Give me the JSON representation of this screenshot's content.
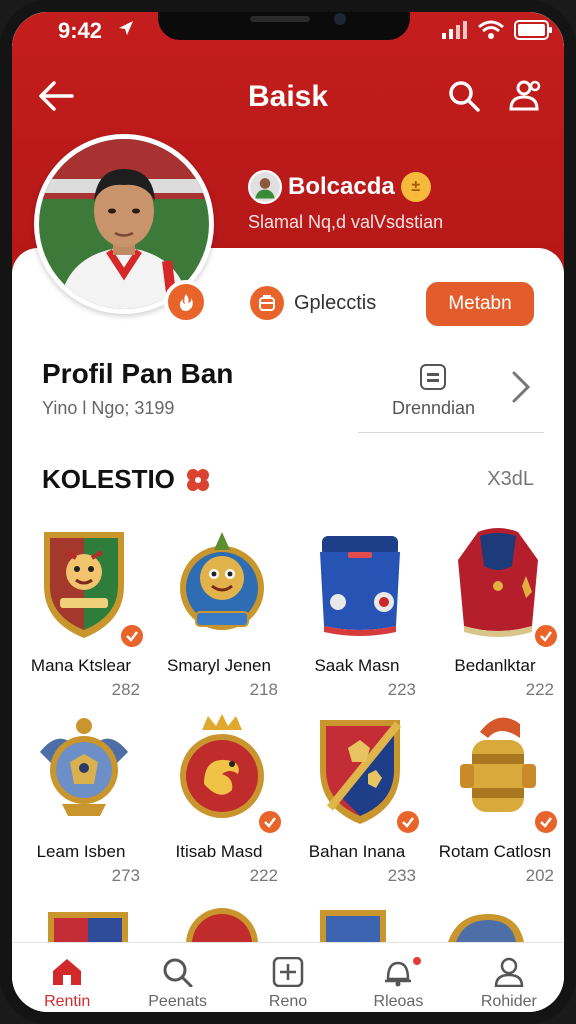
{
  "status": {
    "time": "9:42"
  },
  "app_bar": {
    "title": "Baisk"
  },
  "profile": {
    "club_name": "Bolcacda",
    "subtitle": "Slamal Nq,d valVsdstian",
    "stat_label": "Gplecctis",
    "follow_label": "Metabn",
    "title": "Profil Pan Ban",
    "meta": "Yino l Ngo; 3199",
    "detail_label": "Drenndian"
  },
  "collection": {
    "title": "KOLESTIO",
    "count": "X3dL",
    "items": [
      {
        "name": "Mana Ktslear",
        "count": "282",
        "icon": "green-shield-mascot-badge"
      },
      {
        "name": "Smaryl Jenen",
        "count": "218",
        "icon": "lion-mascot-badge"
      },
      {
        "name": "Saak Masn",
        "count": "223",
        "icon": "blue-bag"
      },
      {
        "name": "Bedanlktar",
        "count": "222",
        "icon": "red-jacket"
      },
      {
        "name": "Leam Isben",
        "count": "273",
        "icon": "winged-blue-badge"
      },
      {
        "name": "Itisab Masd",
        "count": "222",
        "icon": "gold-crown-badge"
      },
      {
        "name": "Bahan Inana",
        "count": "233",
        "icon": "red-blue-shield"
      },
      {
        "name": "Rotam Catlosn",
        "count": "202",
        "icon": "gold-bracelet"
      }
    ]
  },
  "tabs": [
    {
      "label": "Rentin",
      "icon": "home-icon",
      "active": true
    },
    {
      "label": "Peenats",
      "icon": "search-icon",
      "active": false
    },
    {
      "label": "Reno",
      "icon": "add-icon",
      "active": false
    },
    {
      "label": "Rleoas",
      "icon": "notification-icon",
      "active": false
    },
    {
      "label": "Rohider",
      "icon": "profile-icon",
      "active": false
    }
  ],
  "colors": {
    "brand_red": "#c41d1d",
    "accent_orange": "#e35d2c"
  }
}
